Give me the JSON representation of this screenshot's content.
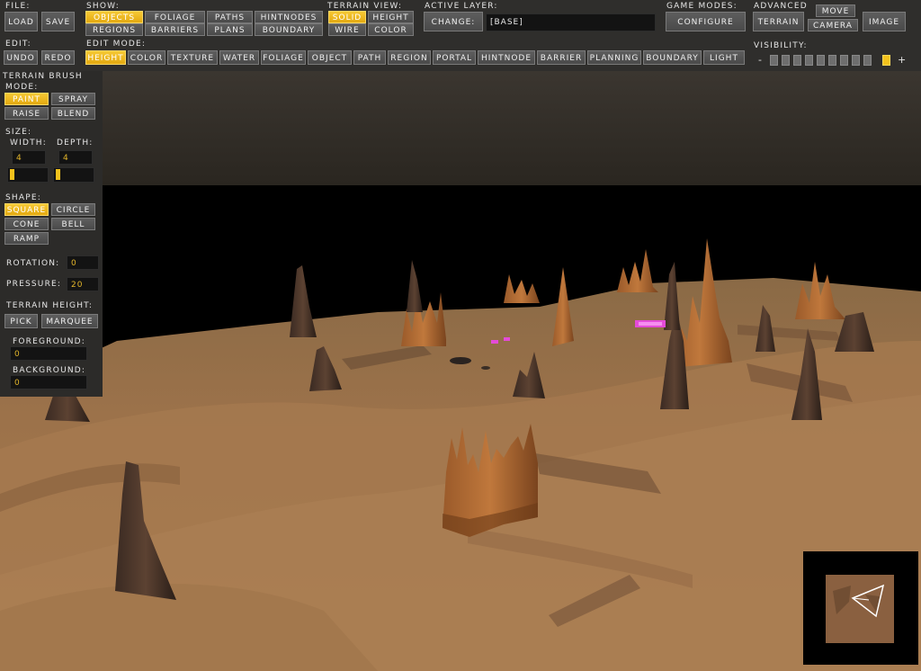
{
  "file": {
    "title": "File:",
    "load": "Load",
    "save": "Save"
  },
  "show": {
    "title": "Show:",
    "objects": "Objects",
    "foliage": "Foliage",
    "paths": "Paths",
    "hintnodes": "HintNodes",
    "regions": "Regions",
    "barriers": "Barriers",
    "plans": "Plans",
    "boundary": "Boundary"
  },
  "terrain_view": {
    "title": "Terrain View:",
    "solid": "Solid",
    "height": "Height",
    "wire": "Wire",
    "color": "Color"
  },
  "active_layer": {
    "title": "Active Layer:",
    "change": "Change:",
    "value": "[Base]"
  },
  "game_modes": {
    "title": "Game Modes:",
    "configure": "Configure"
  },
  "advanced": {
    "title": "Advanced",
    "move": "Move",
    "terrain": "Terrain",
    "camera": "Camera",
    "image": "Image"
  },
  "edit": {
    "title": "Edit:",
    "undo": "Undo",
    "redo": "Redo"
  },
  "edit_mode": {
    "title": "Edit Mode:",
    "items": [
      "Height",
      "Color",
      "Texture",
      "Water",
      "Foliage",
      "Object",
      "Path",
      "Region",
      "Portal",
      "HintNode",
      "Barrier",
      "Planning",
      "Boundary",
      "Light"
    ],
    "active": "Height"
  },
  "visibility": {
    "title": "Visibility:",
    "minus": "-",
    "plus": "+",
    "levels": 10,
    "active_level": 10
  },
  "brush": {
    "title": "Terrain Brush",
    "mode_title": "Mode:",
    "paint": "Paint",
    "spray": "Spray",
    "raise": "Raise",
    "blend": "Blend",
    "size_title": "Size:",
    "width_label": "Width:",
    "depth_label": "Depth:",
    "width": "4",
    "depth": "4",
    "width_slider": 0.05,
    "depth_slider": 0.05,
    "shape_title": "Shape:",
    "square": "Square",
    "circle": "Circle",
    "cone": "Cone",
    "bell": "Bell",
    "ramp": "Ramp",
    "rotation_label": "Rotation:",
    "rotation": "0",
    "pressure_label": "Pressure:",
    "pressure": "20",
    "terrain_height_title": "Terrain Height:",
    "pick": "Pick",
    "marquee": "Marquee",
    "foreground_label": "Foreground:",
    "foreground": "0",
    "background_label": "Background:",
    "background": "0"
  },
  "colors": {
    "accent": "#f3c21c",
    "toolbar": "#2f2e2c",
    "button": "#545454",
    "sand": "#a27346",
    "rock": "#5a3a26"
  }
}
